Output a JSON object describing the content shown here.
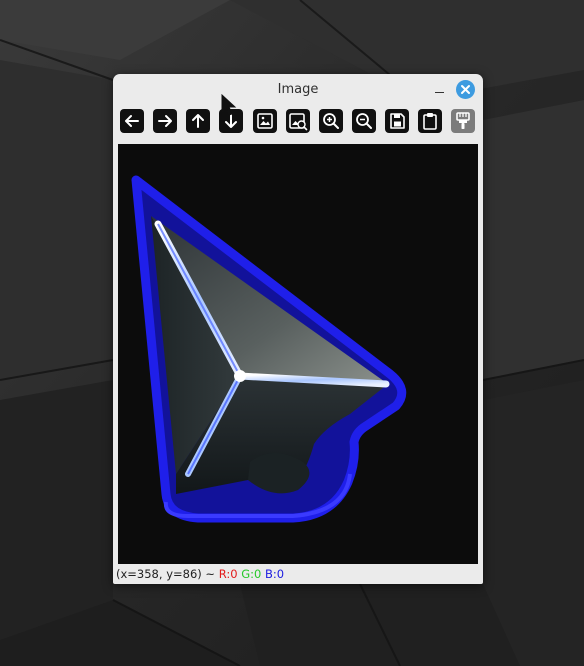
{
  "window": {
    "title": "Image"
  },
  "toolbar": {
    "buttons": [
      {
        "icon": "arrow-left-icon",
        "tooltip": "Pan left"
      },
      {
        "icon": "arrow-right-icon",
        "tooltip": "Pan right"
      },
      {
        "icon": "arrow-up-icon",
        "tooltip": "Pan up"
      },
      {
        "icon": "arrow-down-icon",
        "tooltip": "Pan down"
      },
      {
        "icon": "fit-image-icon",
        "tooltip": "Zoom to fit"
      },
      {
        "icon": "original-size-icon",
        "tooltip": "Original size"
      },
      {
        "icon": "zoom-in-icon",
        "tooltip": "Zoom in"
      },
      {
        "icon": "zoom-out-icon",
        "tooltip": "Zoom out"
      },
      {
        "icon": "save-icon",
        "tooltip": "Save"
      },
      {
        "icon": "clipboard-icon",
        "tooltip": "Copy to clipboard"
      },
      {
        "icon": "properties-icon",
        "tooltip": "Properties",
        "disabled": true
      }
    ]
  },
  "statusbar": {
    "coords": "(x=358, y=86) ~",
    "r": "R:0",
    "g": "G:0",
    "b": "B:0"
  },
  "colors": {
    "close_button": "#3d9be0",
    "outline_blue": "#1c1ce8",
    "canvas_bg": "#0c0c0c",
    "status_r": "#e21b1b",
    "status_g": "#27c92a",
    "status_b": "#1b1be0"
  }
}
